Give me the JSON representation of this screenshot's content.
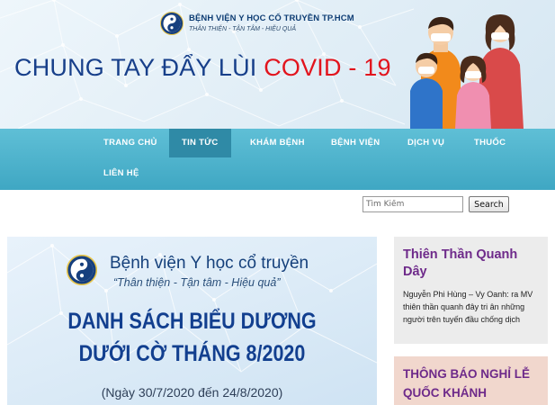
{
  "header": {
    "hospital_name": "BỆNH VIỆN Y HỌC CỔ TRUYỀN TP.HCM",
    "slogan": "THÂN THIỆN - TẬN TÂM - HIỆU QUẢ",
    "headline_main": "CHUNG TAY ĐẨY LÙI",
    "headline_accent": "COVID - 19"
  },
  "nav": {
    "items": [
      {
        "label": "TRANG CHỦ"
      },
      {
        "label": "TIN TỨC",
        "active": true
      },
      {
        "label": "KHÁM BỆNH"
      },
      {
        "label": "BỆNH VIỆN"
      },
      {
        "label": "DỊCH VỤ"
      },
      {
        "label": "THUỐC"
      },
      {
        "label": "LIÊN HỆ"
      }
    ]
  },
  "search": {
    "placeholder": "Tìm Kiếm",
    "button_label": "Search"
  },
  "featured": {
    "hospital_name": "Bệnh viện Y học cổ truyền",
    "slogan": "“Thân thiện - Tận tâm - Hiệu quả”",
    "title_line1": "DANH SÁCH BIỂU DƯƠNG",
    "title_line2": "DƯỚI CỜ THÁNG 8/2020",
    "date_range": "(Ngày 30/7/2020 đến 24/8/2020)"
  },
  "sidebar": {
    "card1": {
      "title": "Thiên Thần Quanh Dây",
      "excerpt": "Nguyễn Phi Hùng – Vy Oanh: ra MV thiên thần quanh đây tri ân những người trên tuyến đầu chống dịch"
    },
    "card2": {
      "title": "THÔNG BÁO NGHỈ LỄ QUỐC KHÁNH"
    }
  },
  "colors": {
    "nav_bg": "#4bb3cc",
    "nav_active": "#2f8aa6",
    "headline_blue": "#173f8a",
    "headline_red": "#e2141d",
    "card_title": "#6e2a8a"
  }
}
